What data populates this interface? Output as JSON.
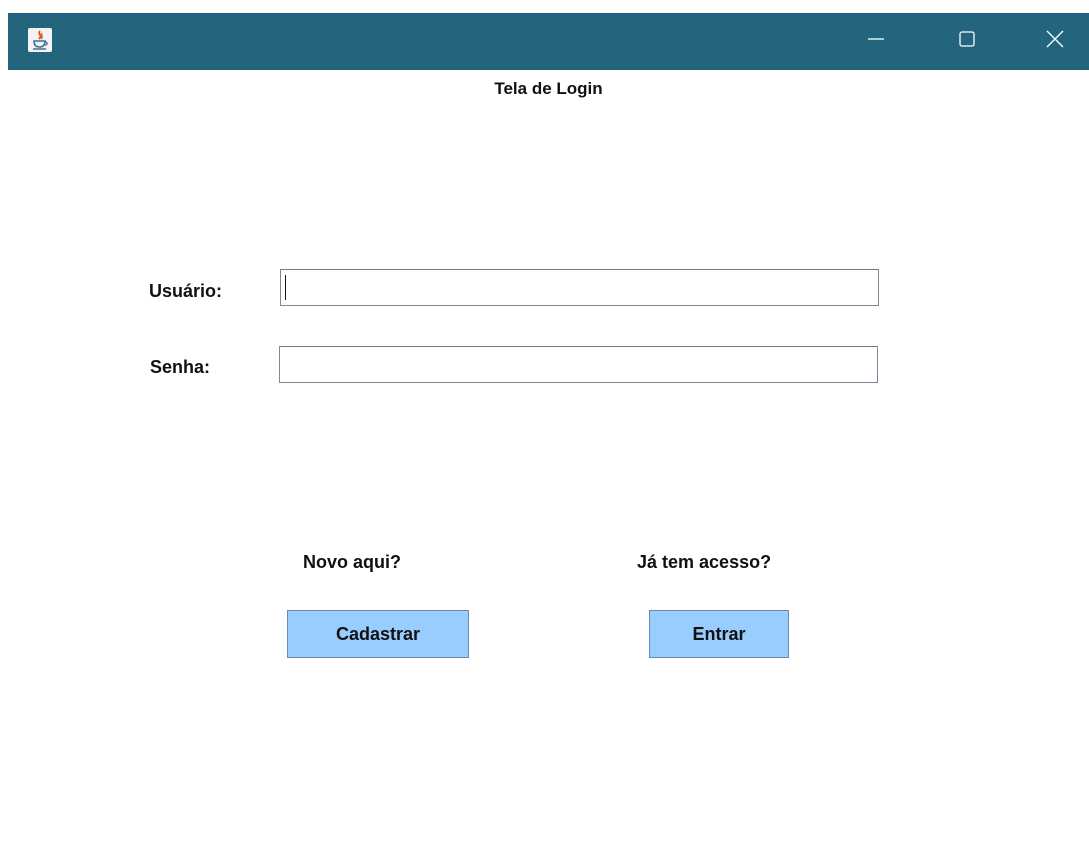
{
  "window": {
    "titlebar_color": "#22657d",
    "app_icon": "java-cup-icon",
    "controls": {
      "minimize_icon": "minimize-icon",
      "maximize_icon": "maximize-icon",
      "close_icon": "close-icon"
    }
  },
  "form": {
    "title": "Tela de Login",
    "username_label": "Usuário:",
    "username_value": "",
    "password_label": "Senha:",
    "password_value": ""
  },
  "actions": {
    "new_hint": "Novo aqui?",
    "register_label": "Cadastrar",
    "existing_hint": "Já tem acesso?",
    "login_label": "Entrar",
    "button_color": "#99ccff"
  }
}
